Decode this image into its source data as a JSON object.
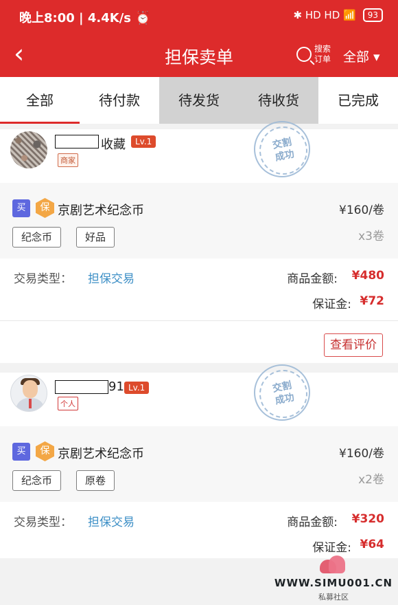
{
  "status_bar": {
    "time_speed": "晚上8:00 | 4.4K/s ⏰",
    "icons": "✱ HD HD 📶",
    "battery": "93"
  },
  "nav": {
    "back_icon": "‹",
    "title": "担保卖单",
    "search_label": "搜索订单",
    "filter_label": "全部 ▾"
  },
  "tabs": [
    {
      "label": "全部"
    },
    {
      "label": "待付款"
    },
    {
      "label": "待发货"
    },
    {
      "label": "待收货"
    },
    {
      "label": "已完成"
    }
  ],
  "orders": [
    {
      "seller_suffix": "收藏",
      "level": "Lv.1",
      "seller_type": "商家",
      "stamp": "交割成功",
      "buy_badge": "买",
      "guarantee_badge": "保",
      "product": "京剧艺术纪念币",
      "tags": [
        "纪念币",
        "好品"
      ],
      "unit_price": "¥160/卷",
      "quantity": "x3卷",
      "trade_label": "交易类型：",
      "trade_value": "担保交易",
      "amount_label": "商品金额:",
      "amount_value": "¥480",
      "deposit_label": "保证金:",
      "deposit_value": "¥72",
      "action_label": "查看评价"
    },
    {
      "seller_suffix": "91",
      "level": "Lv.1",
      "seller_type": "个人",
      "stamp": "交割成功",
      "buy_badge": "买",
      "guarantee_badge": "保",
      "product": "京剧艺术纪念币",
      "tags": [
        "纪念币",
        "原卷"
      ],
      "unit_price": "¥160/卷",
      "quantity": "x2卷",
      "trade_label": "交易类型：",
      "trade_value": "担保交易",
      "amount_label": "商品金额:",
      "amount_value": "¥320",
      "deposit_label": "保证金:",
      "deposit_value": "¥64"
    }
  ],
  "watermark": {
    "url": "WWW.SIMU001.CN",
    "subtitle": "私募社区"
  }
}
